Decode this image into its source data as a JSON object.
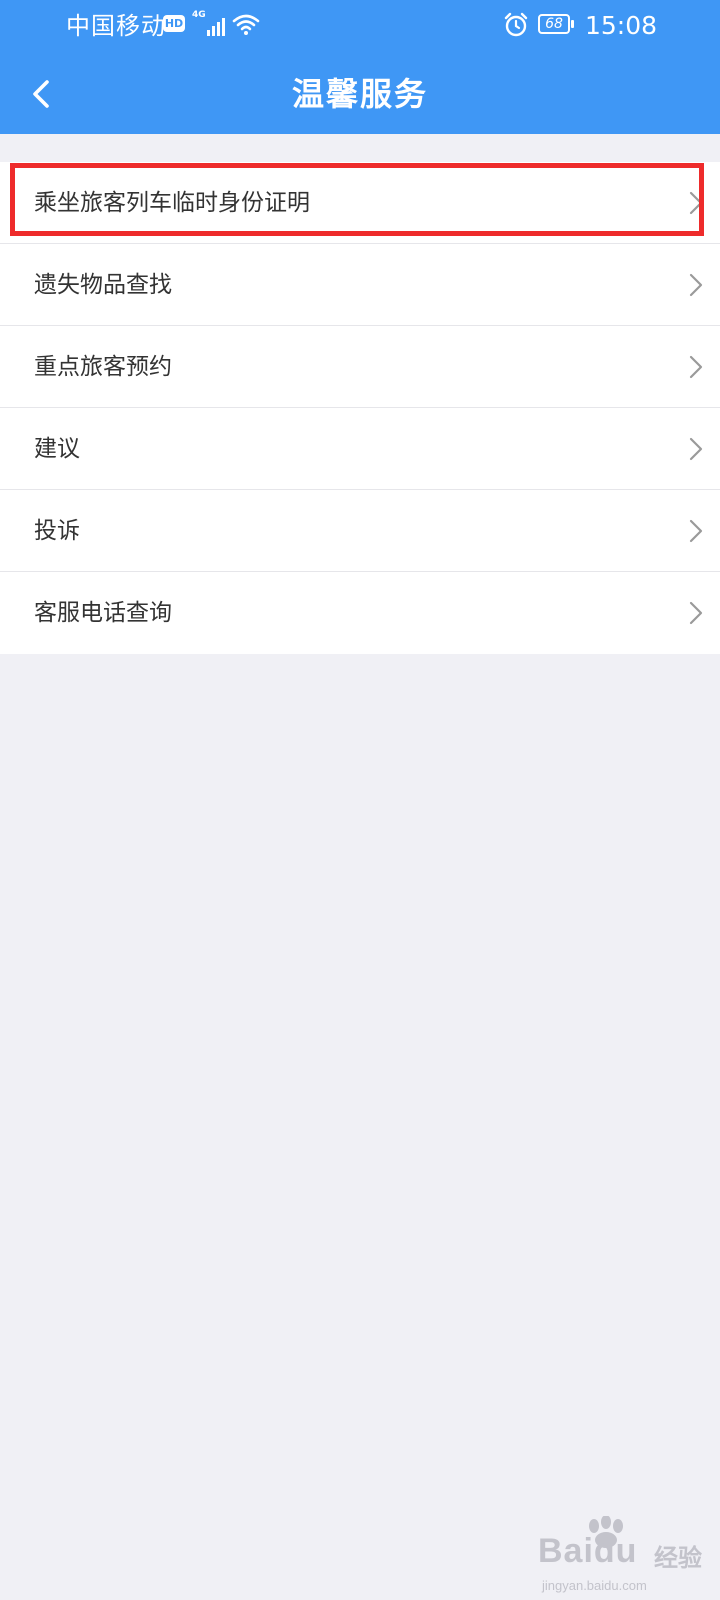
{
  "status_bar": {
    "carrier": "中国移动",
    "hd_badge": "HD",
    "network_type": "4G",
    "icons": [
      "signal-icon",
      "wifi-icon",
      "alarm-icon",
      "battery-icon"
    ],
    "battery_level": "68",
    "time": "15:08"
  },
  "header": {
    "title": "温馨服务",
    "back_icon": "chevron-left-icon",
    "background_color": "#3f97f5"
  },
  "menu": {
    "chevron_icon": "chevron-right-icon",
    "items": [
      {
        "label": "乘坐旅客列车临时身份证明",
        "highlighted": true
      },
      {
        "label": "遗失物品查找",
        "highlighted": false
      },
      {
        "label": "重点旅客预约",
        "highlighted": false
      },
      {
        "label": "建议",
        "highlighted": false
      },
      {
        "label": "投诉",
        "highlighted": false
      },
      {
        "label": "客服电话查询",
        "highlighted": false
      }
    ]
  },
  "highlight_color": "#ee2b2b",
  "watermark": {
    "brand": "Baidu",
    "product": "经验",
    "url": "jingyan.baidu.com"
  }
}
